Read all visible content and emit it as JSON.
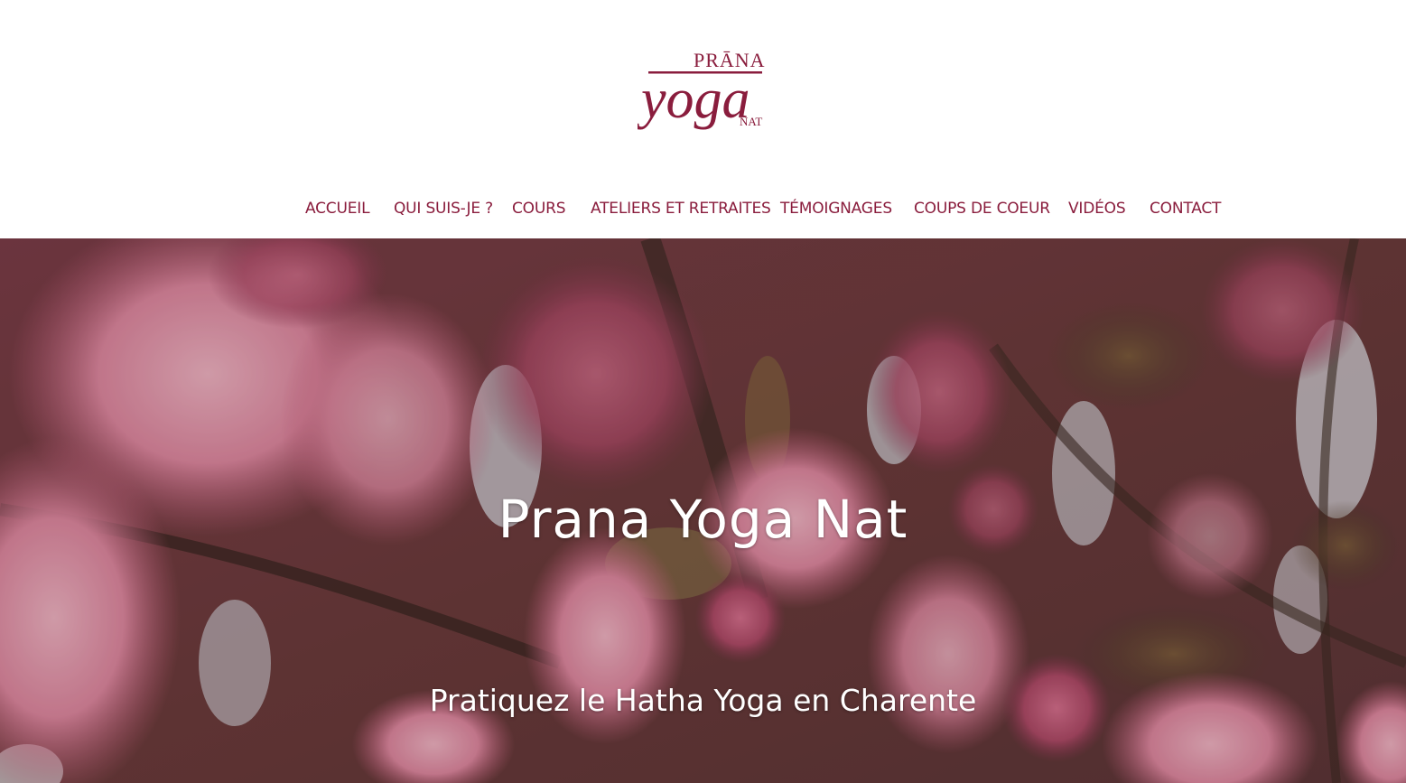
{
  "brand": {
    "logo_top": "PRĀNA",
    "logo_main": "yoga",
    "logo_bottom": "NAT",
    "color": "#8a1d3d"
  },
  "nav": {
    "items": [
      {
        "label": "ACCUEIL"
      },
      {
        "label": "QUI SUIS-JE ?"
      },
      {
        "label": "COURS"
      },
      {
        "label": "ATELIERS ET RETRAITES"
      },
      {
        "label": "TÉMOIGNAGES"
      },
      {
        "label": "COUPS DE COEUR"
      },
      {
        "label": "VIDÉOS"
      },
      {
        "label": "CONTACT"
      }
    ]
  },
  "hero": {
    "title": "Prana Yoga Nat",
    "subtitle": "Pratiquez le Hatha Yoga en Charente",
    "image": "cherry-blossom-photo"
  }
}
